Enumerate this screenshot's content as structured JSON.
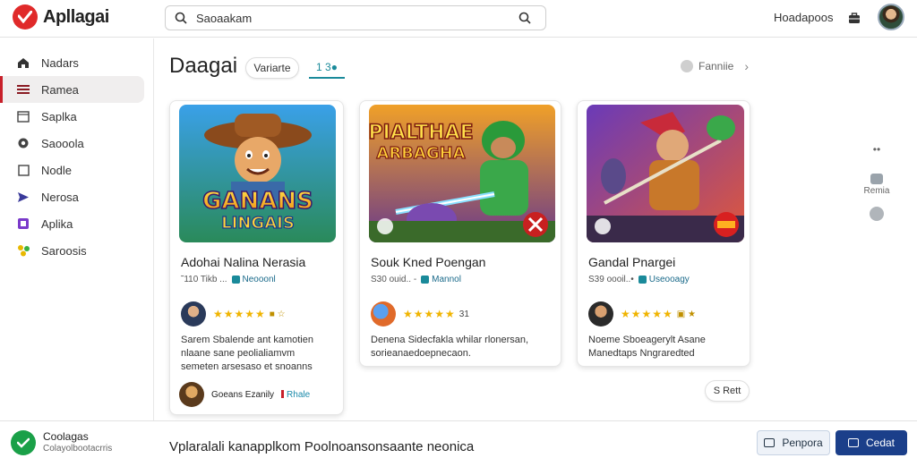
{
  "app": {
    "title": "Apllagai"
  },
  "search": {
    "value": "Saoaakam"
  },
  "topbar": {
    "label": "Hoadapoos"
  },
  "sidebar": {
    "items": [
      {
        "label": "Nadars",
        "icon": "home-icon"
      },
      {
        "label": "Ramea",
        "icon": "menu-icon",
        "active": true
      },
      {
        "label": "Saplka",
        "icon": "window-icon"
      },
      {
        "label": "Saooola",
        "icon": "gear-icon"
      },
      {
        "label": "Nodle",
        "icon": "square-icon"
      },
      {
        "label": "Nerosa",
        "icon": "send-icon"
      },
      {
        "label": "Aplika",
        "icon": "app-icon"
      },
      {
        "label": "Saroosis",
        "icon": "star-cluster-icon"
      }
    ]
  },
  "main": {
    "title": "Daagai",
    "chip_label": "Variarte",
    "tab_label": "1 3●",
    "filter_label": "Fanniie"
  },
  "cards": [
    {
      "thumb_title": "GANANS",
      "thumb_subtitle": "LINGAIS",
      "title": "Adohai Nalina Nerasia",
      "meta": "˜110 Tikb ...",
      "tag": "Neooonl",
      "stars": "★★★★★",
      "rate_extra": "■ ☆",
      "desc": "Sarem Sbalende ant kamotien nlaane sane peolialiamvm semeten arsesaso et snoanns",
      "footer_name": "Goeans Ezanily",
      "footer_link": "Rhale"
    },
    {
      "thumb_title": "PIALTHAE",
      "thumb_subtitle": "ARBAGHA",
      "title": "Souk Kned Poengan",
      "meta": "S30 ouid.. -",
      "tag": "Mannol",
      "stars": "★★★★★",
      "rate_extra": "31",
      "desc": "Denena Sidecfakla whilar rlonersan, sorieanaedoepnecaon."
    },
    {
      "title": "Gandal Pnargei",
      "meta": "S39 oooil..•",
      "tag": "Useooagy",
      "stars": "★★★★★",
      "rate_extra": "▣ ★",
      "desc": "Noeme Sboeagerylt Asane Manedtaps Nngraredted"
    }
  ],
  "more_label": "S Rett",
  "rail": {
    "label": "Remia"
  },
  "bottombar": {
    "name": "Coolagas",
    "sub": "Colayolbootacrris",
    "message": "Vplaralali kanapplkom Poolnoansonsaante neonica",
    "secondary_label": "Penpora",
    "primary_label": "Cedat"
  },
  "colors": {
    "brand": "#e02a2a",
    "accent": "#1a8a9a",
    "primary": "#1b3f8a",
    "star": "#f0b400"
  }
}
